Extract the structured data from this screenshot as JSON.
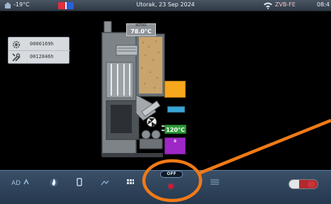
{
  "statusbar": {
    "outdoor_temp": "-19°C",
    "date": "Utorak, 23 Sep 2024",
    "device": "ZVB-FE",
    "time": "08:4"
  },
  "counters": [
    {
      "icon": "gear-icon",
      "value": "0000169h"
    },
    {
      "icon": "tools-icon",
      "value": "0012846h"
    }
  ],
  "boiler": {
    "top_label": "KOTAO",
    "top_temp": "78.0°C",
    "hopper_label": "",
    "green_temp": "120°C",
    "purple_value": "0"
  },
  "toolbar": {
    "status_label": "OFF",
    "items": [
      "auto-icon",
      "flame-icon",
      "phone-icon",
      "chart-icon",
      "grid-icon",
      "power-icon",
      "menu-icon",
      "toggle"
    ]
  },
  "colors": {
    "status_bar": "#3a4553",
    "toolbar": "#2d4259",
    "annotation": "#f07a17"
  }
}
